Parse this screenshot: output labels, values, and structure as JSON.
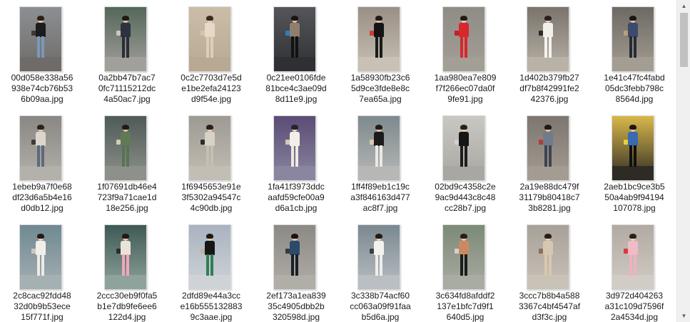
{
  "files": [
    {
      "line1": "00d058e338a56",
      "line2": "938e74cb76b53",
      "line3": "6b09aa.jpg",
      "palette": {
        "bg": "#8c8f92",
        "ground": "#6e6b68",
        "hair": "#2a211c",
        "skin": "#e8c6b0",
        "top": "#1c1c1c",
        "bottom": "#7b98b8",
        "bag": "#3a3a3a"
      }
    },
    {
      "line1": "0a2bb47b7ac7",
      "line2": "0fc71115212dc",
      "line3": "4a50ac7.jpg",
      "palette": {
        "bg": "#55675a",
        "ground": "#a2a09b",
        "hair": "#1e1a17",
        "skin": "#e6c4ac",
        "top": "#2b3340",
        "bottom": "#2a2e36",
        "bag": "#cfc5b7"
      }
    },
    {
      "line1": "0c2c7703d7e5d",
      "line2": "e1be2efa24123",
      "line3": "d9f54e.jpg",
      "palette": {
        "bg": "#cbbda8",
        "ground": "#b8a993",
        "hair": "#3a2a20",
        "skin": "#f0d2bd",
        "top": "#e8d8c8",
        "bottom": "#e0cdb8",
        "bag": "#d5c3ad"
      }
    },
    {
      "line1": "0c21ee0106fde",
      "line2": "81bce4c3ae09d",
      "line3": "8d11e9.jpg",
      "palette": {
        "bg": "#54565a",
        "ground": "#2f3033",
        "hair": "#1a1512",
        "skin": "#e3c0a8",
        "top": "#8f7f70",
        "bottom": "#121212",
        "bag": "#2a7fc0"
      }
    },
    {
      "line1": "1a58930fb23c6",
      "line2": "5d9ce3fde8e8c",
      "line3": "7ea65a.jpg",
      "palette": {
        "bg": "#9a8f86",
        "ground": "#c8c1b4",
        "hair": "#231b16",
        "skin": "#e4c2aa",
        "top": "#141414",
        "bottom": "#1a1a1a",
        "bag": "#d43c30"
      }
    },
    {
      "line1": "1aa980ea7e809",
      "line2": "f7f266ec07da0f",
      "line3": "9fe91.jpg",
      "palette": {
        "bg": "#8f8c86",
        "ground": "#a39f96",
        "hair": "#241b15",
        "skin": "#ecd0bb",
        "top": "#d8272d",
        "bottom": "#d8272d",
        "bag": "#c22026"
      }
    },
    {
      "line1": "1d402b379fb27",
      "line2": "df7b8f42991fe2",
      "line3": "42376.jpg",
      "palette": {
        "bg": "#7b746c",
        "ground": "#b9b2a7",
        "hair": "#2a211c",
        "skin": "#e9c9b3",
        "top": "#f2f0ea",
        "bottom": "#f4f2ec",
        "bag": "#2a2a2a"
      }
    },
    {
      "line1": "1e41c47fc4fabd",
      "line2": "05dc3febb798c",
      "line3": "8564d.jpg",
      "palette": {
        "bg": "#6c6a64",
        "ground": "#a49d92",
        "hair": "#1c1714",
        "skin": "#e3bfa6",
        "top": "#3a4b6e",
        "bottom": "#262b36",
        "bag": "#b9a27a"
      }
    },
    {
      "line1": "1ebeb9a7f0e68",
      "line2": "df23d6a5b4e16",
      "line3": "d0db12.jpg",
      "palette": {
        "bg": "#8a8784",
        "ground": "#b4b0aa",
        "hair": "#2b221c",
        "skin": "#e8c8b2",
        "top": "#dcd6cc",
        "bottom": "#5d6a7c",
        "bag": "#3b3b3b"
      }
    },
    {
      "line1": "1f07691db46e4",
      "line2": "723f9a71cae1d",
      "line3": "18e256.jpg",
      "palette": {
        "bg": "#4f5b57",
        "ground": "#8e918b",
        "hair": "#221a15",
        "skin": "#e4c3ab",
        "top": "#5f7a54",
        "bottom": "#597351",
        "bag": "#cfcabf"
      }
    },
    {
      "line1": "1f6945653e91e",
      "line2": "3f5302a94547c",
      "line3": "4c90db.jpg",
      "palette": {
        "bg": "#9d9a94",
        "ground": "#c3beb5",
        "hair": "#2a1f19",
        "skin": "#eccfba",
        "top": "#d8d2c6",
        "bottom": "#c6bfb1",
        "bag": "#2c2c2c"
      }
    },
    {
      "line1": "1fa41f3973ddc",
      "line2": "aafd59cfe00a9",
      "line3": "d6a1cb.jpg",
      "palette": {
        "bg": "#5a4c76",
        "ground": "#8b86a0",
        "hair": "#2a2029",
        "skin": "#efd2c2",
        "top": "#f3eee8",
        "bottom": "#efe9e1",
        "bag": "#d6c9b8"
      }
    },
    {
      "line1": "1ff4f89eb1c19c",
      "line2": "a3f846163d477",
      "line3": "ac8f7.jpg",
      "palette": {
        "bg": "#7e8a8f",
        "ground": "#b7b8b5",
        "hair": "#231b16",
        "skin": "#e6c5ae",
        "top": "#1b1b1b",
        "bottom": "#ece9e4",
        "bag": "#d9c9b3"
      }
    },
    {
      "line1": "02bd9c4358c2e",
      "line2": "9ac9d443c8c48",
      "line3": "cc28b7.jpg",
      "palette": {
        "bg": "#c9c7c2",
        "ground": "#a9a7a2",
        "hair": "#2a201a",
        "skin": "#e8c7b0",
        "top": "#161616",
        "bottom": "#1d1d1d",
        "bag": "#d2cfc9"
      }
    },
    {
      "line1": "2a19e88dc479f",
      "line2": "31179b80418c7",
      "line3": "3b8281.jpg",
      "palette": {
        "bg": "#7d7670",
        "ground": "#a49c92",
        "hair": "#211914",
        "skin": "#e7c5ad",
        "top": "#6f7c8c",
        "bottom": "#3f4350",
        "bag": "#b53b35"
      }
    },
    {
      "line1": "2aeb1bc9ce3b5",
      "line2": "50a4ab9f94194",
      "line3": "107078.jpg",
      "palette": {
        "bg": "#d9b84a",
        "ground": "#2e2b26",
        "hair": "#1d1612",
        "skin": "#e6c4ab",
        "top": "#3a6ab0",
        "bottom": "#101010",
        "bag": "#e7d13b"
      }
    },
    {
      "line1": "2c8cac92fdd48",
      "line2": "32d0b9b53ece",
      "line3": "15f771f.jpg",
      "palette": {
        "bg": "#6f8992",
        "ground": "#a5b0b3",
        "hair": "#241c17",
        "skin": "#ecd0bb",
        "top": "#f1efeb",
        "bottom": "#eeebe6",
        "bag": "#d0c7bb"
      }
    },
    {
      "line1": "2ccc30eb9f0fa5",
      "line2": "b1e7db9fe6ee6",
      "line3": "122d4.jpg",
      "palette": {
        "bg": "#3f5a55",
        "ground": "#8fa39c",
        "hair": "#221a15",
        "skin": "#e9c8b1",
        "top": "#e9e3da",
        "bottom": "#f1a7bb",
        "bag": "#2c2c2c"
      }
    },
    {
      "line1": "2dfd89e44a3cc",
      "line2": "e16b555132883",
      "line3": "9c3aae.jpg",
      "palette": {
        "bg": "#a9b3c0",
        "ground": "#cfd3d8",
        "hair": "#1f1813",
        "skin": "#e8c6ae",
        "top": "#161616",
        "bottom": "#2f7d57",
        "bag": "#c0b39b"
      }
    },
    {
      "line1": "2ef173a1ea839",
      "line2": "35c4905dbb2b",
      "line3": "320598d.jpg",
      "palette": {
        "bg": "#8c8a86",
        "ground": "#b1ada7",
        "hair": "#171311",
        "skin": "#e3bea4",
        "top": "#2c4a6a",
        "bottom": "#1b1e26",
        "bag": "#3a3a3a"
      }
    },
    {
      "line1": "3c338b74acf60",
      "line2": "cc063a09f91faa",
      "line3": "b5d6a.jpg",
      "palette": {
        "bg": "#7b8890",
        "ground": "#b9bfc2",
        "hair": "#221a15",
        "skin": "#e9c9b2",
        "top": "#f4f2ee",
        "bottom": "#f1eeea",
        "bag": "#3d3d3d"
      }
    },
    {
      "line1": "3c634fd8afddf2",
      "line2": "137e1bfc7d9f1",
      "line3": "640d5.jpg",
      "palette": {
        "bg": "#7c8a78",
        "ground": "#a9aca2",
        "hair": "#271e18",
        "skin": "#e8c5ac",
        "top": "#c98a62",
        "bottom": "#1c1c1c",
        "bag": "#d8d0c4"
      }
    },
    {
      "line1": "3ccc7b8b4a588",
      "line2": "3367c4bf4547af",
      "line3": "d3f3c.jpg",
      "palette": {
        "bg": "#a7a199",
        "ground": "#c9c2b7",
        "hair": "#2a1f18",
        "skin": "#ecd0bb",
        "top": "#d7c6b0",
        "bottom": "#d9c7b0",
        "bag": "#8b6f55"
      }
    },
    {
      "line1": "3d972d404263",
      "line2": "a31c109d7596f",
      "line3": "2a4534d.jpg",
      "palette": {
        "bg": "#b1aaa3",
        "ground": "#d1ccc5",
        "hair": "#2b211b",
        "skin": "#edd2bf",
        "top": "#f2b9c6",
        "bottom": "#efb2c1",
        "bag": "#d83a3a"
      }
    }
  ],
  "scrollbar": {
    "up_icon": "▲",
    "down_icon": "▼"
  }
}
